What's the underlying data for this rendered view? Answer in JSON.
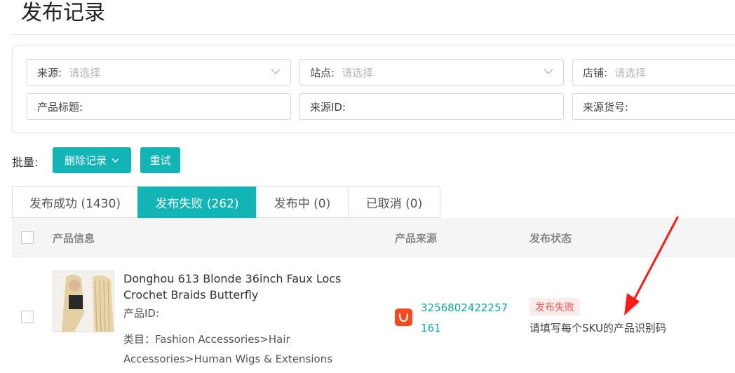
{
  "page": {
    "title": "发布记录"
  },
  "filters": {
    "row1": [
      {
        "label": "来源:",
        "placeholder": "请选择"
      },
      {
        "label": "站点:",
        "placeholder": "请选择"
      },
      {
        "label": "店铺:",
        "placeholder": "请选择"
      }
    ],
    "row2": [
      {
        "label": "产品标题:"
      },
      {
        "label": "来源ID:"
      },
      {
        "label": "来源货号:"
      }
    ]
  },
  "batch": {
    "label": "批量:",
    "delete_label": "删除记录",
    "retry_label": "重试"
  },
  "tabs": [
    {
      "label": "发布成功 (1430)"
    },
    {
      "label": "发布失败 (262)"
    },
    {
      "label": "发布中 (0)"
    },
    {
      "label": "已取消 (0)"
    }
  ],
  "table": {
    "headers": {
      "product_info": "产品信息",
      "product_source": "产品来源",
      "publish_status": "发布状态"
    },
    "rows": [
      {
        "title": "Donghou 613 Blonde 36inch Faux Locs Crochet Braids Butterfly",
        "product_id_label": "产品ID:",
        "category": "类目：Fashion Accessories>Hair Accessories>Human Wigs & Extensions",
        "source_id": "3256802422257161",
        "status": "发布失败",
        "status_message": "请填写每个SKU的产品识别码"
      }
    ]
  },
  "colors": {
    "accent": "#12b4b5",
    "error": "#f05757",
    "error_bg": "#fdecec",
    "link": "#14a6a7",
    "annotation": "#ff1a1a"
  }
}
